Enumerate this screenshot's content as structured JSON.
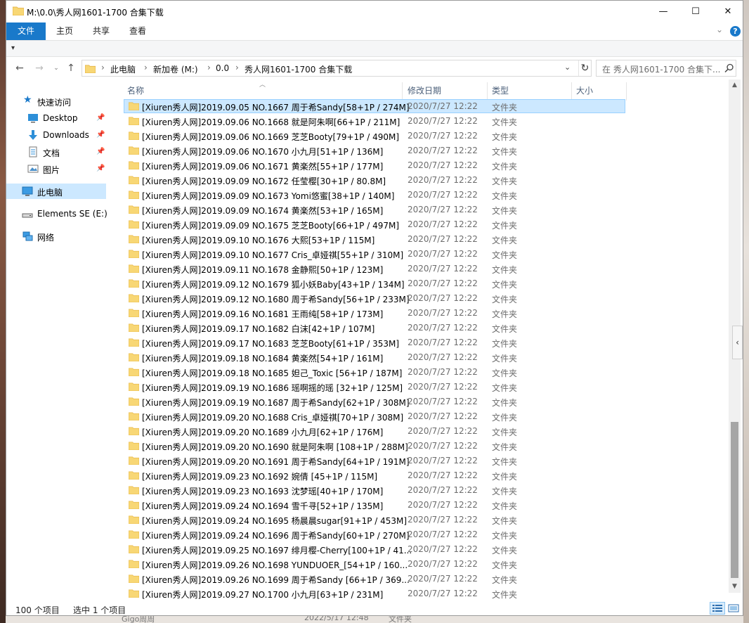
{
  "window": {
    "title": "M:\\0.0\\秀人网1601-1700 合集下载",
    "minimize_glyph": "—",
    "maximize_glyph": "☐",
    "close_glyph": "✕"
  },
  "ribbon": {
    "tabs": [
      {
        "label": "文件",
        "active": true
      },
      {
        "label": "主页",
        "active": false
      },
      {
        "label": "共享",
        "active": false
      },
      {
        "label": "查看",
        "active": false
      }
    ],
    "expand_glyph": "⌄",
    "help_glyph": "?"
  },
  "address": {
    "breadcrumbs": [
      "此电脑",
      "新加卷 (M:)",
      "0.0",
      "秀人网1601-1700 合集下载"
    ],
    "separator": "›"
  },
  "search": {
    "placeholder": "在 秀人网1601-1700 合集下..."
  },
  "nav": {
    "items": [
      {
        "label": "快速访问",
        "icon": "star-icon",
        "pinned": false
      },
      {
        "label": "Desktop",
        "icon": "desktop-icon",
        "pinned": true
      },
      {
        "label": "Downloads",
        "icon": "download-icon",
        "pinned": true
      },
      {
        "label": "文档",
        "icon": "document-icon",
        "pinned": true
      },
      {
        "label": "图片",
        "icon": "picture-icon",
        "pinned": true
      },
      {
        "label": "此电脑",
        "icon": "computer-icon",
        "pinned": false,
        "selected": true
      },
      {
        "label": "Elements SE (E:)",
        "icon": "drive-icon",
        "pinned": false
      },
      {
        "label": "网络",
        "icon": "network-icon",
        "pinned": false
      }
    ]
  },
  "columns": {
    "name": "名称",
    "date": "修改日期",
    "type": "类型",
    "size": "大小"
  },
  "files": [
    {
      "name": "[Xiuren秀人网]2019.09.05 NO.1667 周于希Sandy[58+1P / 274M]",
      "date": "2020/7/27 12:22",
      "type": "文件夹",
      "selected": true
    },
    {
      "name": "[Xiuren秀人网]2019.09.06 NO.1668 就是阿朱啊[66+1P / 211M]",
      "date": "2020/7/27 12:22",
      "type": "文件夹"
    },
    {
      "name": "[Xiuren秀人网]2019.09.06 NO.1669 芝芝Booty[79+1P / 490M]",
      "date": "2020/7/27 12:22",
      "type": "文件夹"
    },
    {
      "name": "[Xiuren秀人网]2019.09.06 NO.1670 小九月[51+1P / 136M]",
      "date": "2020/7/27 12:22",
      "type": "文件夹"
    },
    {
      "name": "[Xiuren秀人网]2019.09.06 NO.1671 黄楽然[55+1P / 177M]",
      "date": "2020/7/27 12:22",
      "type": "文件夹"
    },
    {
      "name": "[Xiuren秀人网]2019.09.09 NO.1672 任莹樱[30+1P / 80.8M]",
      "date": "2020/7/27 12:22",
      "type": "文件夹"
    },
    {
      "name": "[Xiuren秀人网]2019.09.09 NO.1673 Yomi悠蜜[38+1P / 140M]",
      "date": "2020/7/27 12:22",
      "type": "文件夹"
    },
    {
      "name": "[Xiuren秀人网]2019.09.09 NO.1674 黄楽然[53+1P / 165M]",
      "date": "2020/7/27 12:22",
      "type": "文件夹"
    },
    {
      "name": "[Xiuren秀人网]2019.09.09 NO.1675 芝芝Booty[66+1P / 497M]",
      "date": "2020/7/27 12:22",
      "type": "文件夹"
    },
    {
      "name": "[Xiuren秀人网]2019.09.10 NO.1676 大熙[53+1P / 115M]",
      "date": "2020/7/27 12:22",
      "type": "文件夹"
    },
    {
      "name": "[Xiuren秀人网]2019.09.10 NO.1677 Cris_卓娅祺[55+1P / 310M]",
      "date": "2020/7/27 12:22",
      "type": "文件夹"
    },
    {
      "name": "[Xiuren秀人网]2019.09.11 NO.1678 金静熙[50+1P / 123M]",
      "date": "2020/7/27 12:22",
      "type": "文件夹"
    },
    {
      "name": "[Xiuren秀人网]2019.09.12 NO.1679 狐小妖Baby[43+1P / 134M]",
      "date": "2020/7/27 12:22",
      "type": "文件夹"
    },
    {
      "name": "[Xiuren秀人网]2019.09.12 NO.1680 周于希Sandy[56+1P / 233M]",
      "date": "2020/7/27 12:22",
      "type": "文件夹"
    },
    {
      "name": "[Xiuren秀人网]2019.09.16 NO.1681 王雨纯[58+1P / 173M]",
      "date": "2020/7/27 12:22",
      "type": "文件夹"
    },
    {
      "name": "[Xiuren秀人网]2019.09.17 NO.1682 白沫[42+1P / 107M]",
      "date": "2020/7/27 12:22",
      "type": "文件夹"
    },
    {
      "name": "[Xiuren秀人网]2019.09.17 NO.1683 芝芝Booty[61+1P / 353M]",
      "date": "2020/7/27 12:22",
      "type": "文件夹"
    },
    {
      "name": "[Xiuren秀人网]2019.09.18 NO.1684 黄楽然[54+1P / 161M]",
      "date": "2020/7/27 12:22",
      "type": "文件夹"
    },
    {
      "name": "[Xiuren秀人网]2019.09.18 NO.1685 妲己_Toxic [56+1P / 187M]",
      "date": "2020/7/27 12:22",
      "type": "文件夹"
    },
    {
      "name": "[Xiuren秀人网]2019.09.19 NO.1686 瑶啊摇的瑶 [32+1P / 125M]",
      "date": "2020/7/27 12:22",
      "type": "文件夹"
    },
    {
      "name": "[Xiuren秀人网]2019.09.19 NO.1687 周于希Sandy[62+1P / 308M]",
      "date": "2020/7/27 12:22",
      "type": "文件夹"
    },
    {
      "name": "[Xiuren秀人网]2019.09.20 NO.1688 Cris_卓娅祺[70+1P / 308M]",
      "date": "2020/7/27 12:22",
      "type": "文件夹"
    },
    {
      "name": "[Xiuren秀人网]2019.09.20 NO.1689 小九月[62+1P / 176M]",
      "date": "2020/7/27 12:22",
      "type": "文件夹"
    },
    {
      "name": "[Xiuren秀人网]2019.09.20 NO.1690 就是阿朱啊 [108+1P / 288M]",
      "date": "2020/7/27 12:22",
      "type": "文件夹"
    },
    {
      "name": "[Xiuren秀人网]2019.09.20 NO.1691 周于希Sandy[64+1P / 191M]",
      "date": "2020/7/27 12:22",
      "type": "文件夹"
    },
    {
      "name": "[Xiuren秀人网]2019.09.23 NO.1692 婉倩 [45+1P / 115M]",
      "date": "2020/7/27 12:22",
      "type": "文件夹"
    },
    {
      "name": "[Xiuren秀人网]2019.09.23 NO.1693 沈梦瑶[40+1P / 170M]",
      "date": "2020/7/27 12:22",
      "type": "文件夹"
    },
    {
      "name": "[Xiuren秀人网]2019.09.24 NO.1694 雪千寻[52+1P / 135M]",
      "date": "2020/7/27 12:22",
      "type": "文件夹"
    },
    {
      "name": "[Xiuren秀人网]2019.09.24 NO.1695 杨晨晨sugar[91+1P / 453M]",
      "date": "2020/7/27 12:22",
      "type": "文件夹"
    },
    {
      "name": "[Xiuren秀人网]2019.09.24 NO.1696 周于希Sandy[60+1P / 270M]",
      "date": "2020/7/27 12:22",
      "type": "文件夹"
    },
    {
      "name": "[Xiuren秀人网]2019.09.25 NO.1697 绯月樱-Cherry[100+1P / 41...",
      "date": "2020/7/27 12:22",
      "type": "文件夹"
    },
    {
      "name": "[Xiuren秀人网]2019.09.26 NO.1698 YUNDUOER_[54+1P / 160...",
      "date": "2020/7/27 12:22",
      "type": "文件夹"
    },
    {
      "name": "[Xiuren秀人网]2019.09.26 NO.1699 周于希Sandy [66+1P / 369...",
      "date": "2020/7/27 12:22",
      "type": "文件夹"
    },
    {
      "name": "[Xiuren秀人网]2019.09.27 NO.1700 小九月[63+1P / 231M]",
      "date": "2020/7/27 12:22",
      "type": "文件夹"
    }
  ],
  "status": {
    "count": "100 个项目",
    "selected": "选中 1 个项目"
  },
  "background_peek": {
    "name": "Gigo周周",
    "date": "2022/5/17 12:48",
    "type": "文件夹"
  },
  "colors": {
    "accent": "#1979ca",
    "selection": "#cce8ff",
    "folder": "#f8d775",
    "folder_dark": "#e8b94b"
  }
}
